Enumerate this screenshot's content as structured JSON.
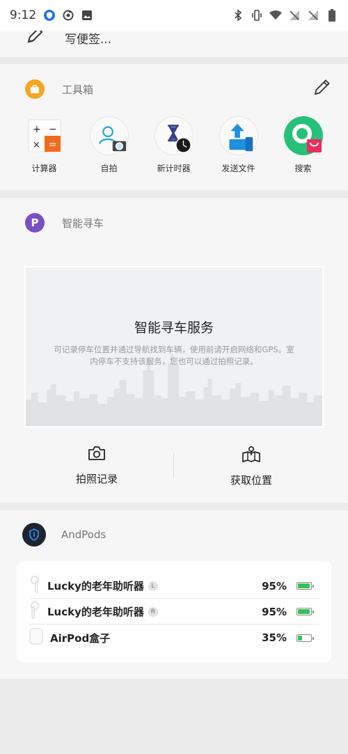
{
  "status_bar": {
    "time": "9:12",
    "left_icons": [
      "shield-app-icon",
      "circle-app-icon",
      "image-icon"
    ],
    "right_icons": [
      "bluetooth-icon",
      "vibrate-icon",
      "wifi-icon",
      "no-signal-icon",
      "no-signal-icon",
      "battery-icon"
    ]
  },
  "note_card": {
    "title": "写便签..."
  },
  "toolbox": {
    "title": "工具箱",
    "tools": [
      {
        "label": "计算器",
        "icon": "calculator-icon"
      },
      {
        "label": "自拍",
        "icon": "selfie-icon"
      },
      {
        "label": "新计时器",
        "icon": "timer-icon"
      },
      {
        "label": "发送文件",
        "icon": "send-file-icon"
      },
      {
        "label": "搜索",
        "icon": "search-app-icon"
      }
    ]
  },
  "car_finder": {
    "title": "智能寻车",
    "badge_letter": "P",
    "service_title": "智能寻车服务",
    "service_desc": "可记录停车位置并通过导航找到车辆，使用前请开启网络和GPS。室内停车不支持该服务，您也可以通过拍照记录。",
    "actions": [
      {
        "label": "拍照记录",
        "icon": "camera-icon"
      },
      {
        "label": "获取位置",
        "icon": "map-location-icon"
      }
    ]
  },
  "andpods": {
    "title": "AndPods",
    "devices": [
      {
        "name": "Lucky的老年助听器",
        "side": "L",
        "percent": "95%",
        "level": 0.95,
        "icon": "airpod-icon"
      },
      {
        "name": "Lucky的老年助听器",
        "side": "R",
        "percent": "95%",
        "level": 0.95,
        "icon": "airpod-icon"
      },
      {
        "name": "AirPod盒子",
        "side": "",
        "percent": "35%",
        "level": 0.35,
        "icon": "airpod-case-icon"
      }
    ]
  },
  "colors": {
    "accent_orange": "#f5a623",
    "purple": "#7a4fc6",
    "battery_green": "#36c25b",
    "search_green": "#27c07a"
  }
}
